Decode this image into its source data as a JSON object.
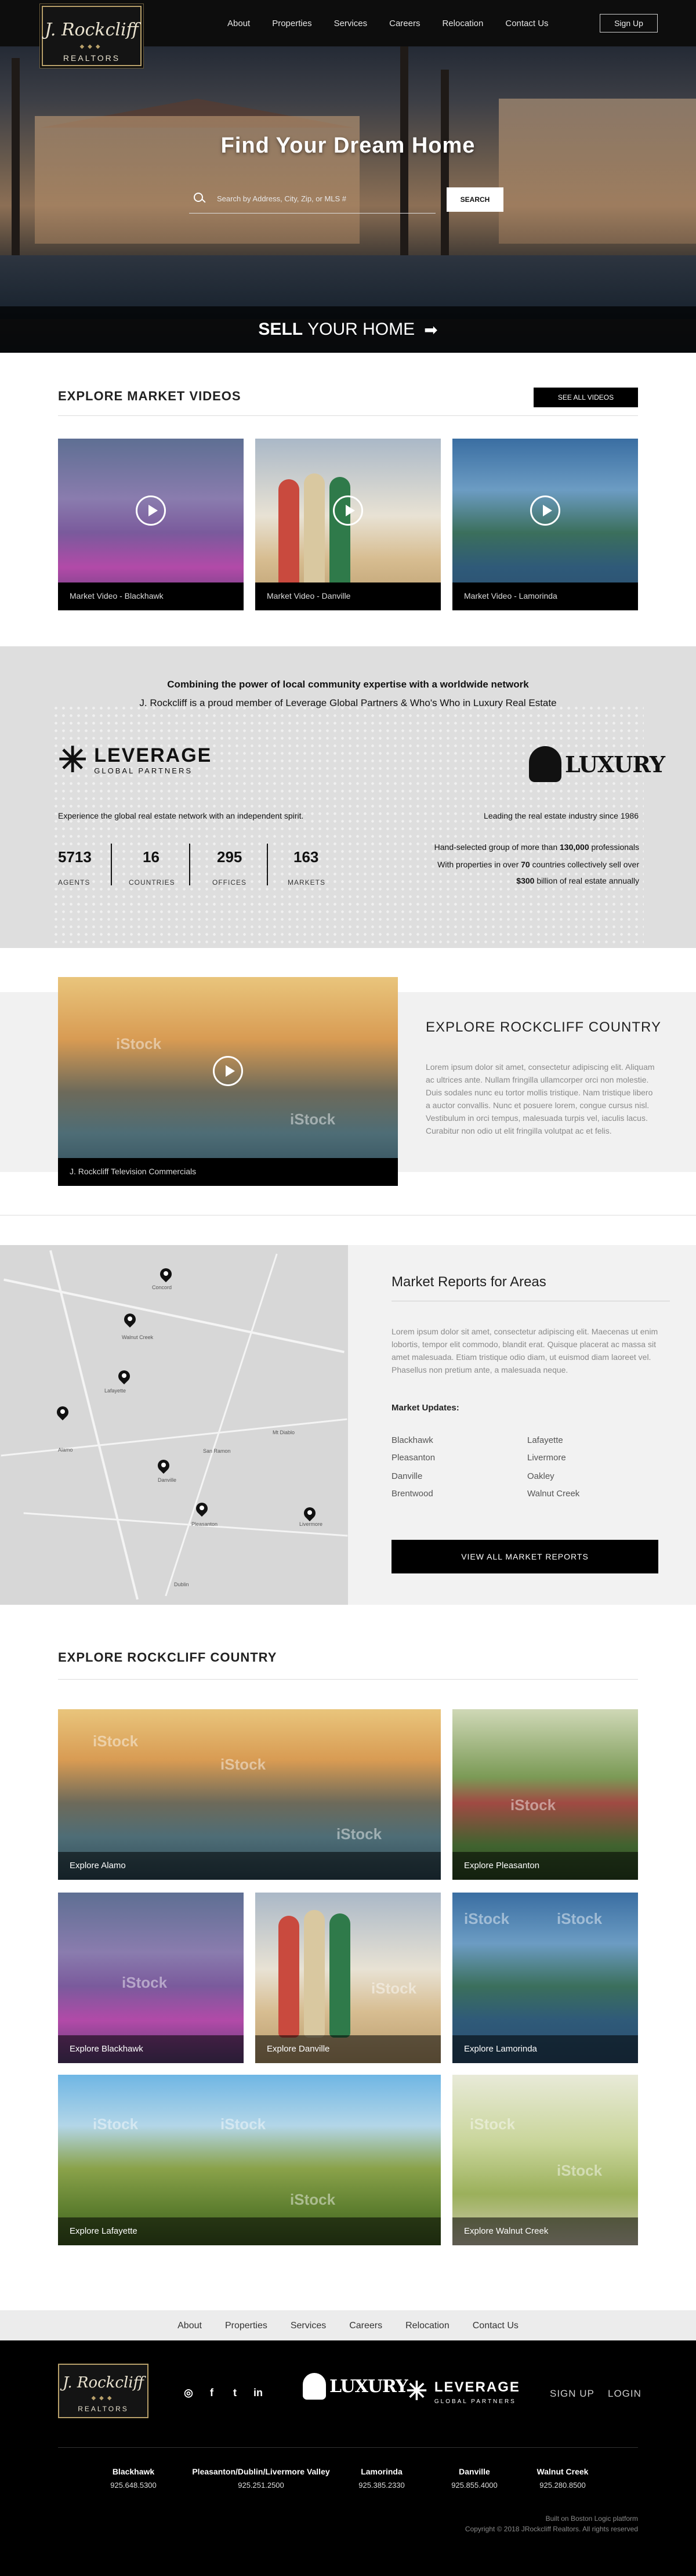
{
  "header": {
    "logo_script": "J. Rockcliff",
    "logo_sub": "REALTORS",
    "nav": [
      "About",
      "Properties",
      "Services",
      "Careers",
      "Relocation",
      "Contact Us"
    ],
    "signup": "Sign Up"
  },
  "hero": {
    "title": "Find Your Dream Home",
    "search_placeholder": "Search by Address, City, Zip, or MLS #",
    "search_button": "SEARCH",
    "sell_bold": "SELL",
    "sell_rest": "YOUR HOME"
  },
  "videos": {
    "title": "EXPLORE MARKET VIDEOS",
    "see_all": "SEE ALL VIDEOS",
    "items": [
      {
        "caption": "Market Video - Blackhawk"
      },
      {
        "caption": "Market Video - Danville"
      },
      {
        "caption": "Market Video - Lamorinda"
      }
    ]
  },
  "leverage": {
    "headline_1": "Combining the power of local community expertise with a worldwide network",
    "headline_2": "J. Rockcliff is a proud member of Leverage Global Partners & Who's Who in Luxury Real Estate",
    "lev_name": "LEVERAGE",
    "lev_sub": "GLOBAL PARTNERS",
    "lux_name": "LUXURY",
    "left_tagline": "Experience the global real estate network with an independent spirit.",
    "right_tagline": "Leading the real estate industry since 1986",
    "stats": [
      {
        "num": "5713",
        "label": "AGENTS"
      },
      {
        "num": "16",
        "label": "COUNTRIES"
      },
      {
        "num": "295",
        "label": "OFFICES"
      },
      {
        "num": "163",
        "label": "MARKETS"
      }
    ],
    "lux_l1_pre": "Hand-selected group of more than ",
    "lux_l1_bold": "130,000",
    "lux_l1_post": " professionals",
    "lux_l2_pre": "With properties in over ",
    "lux_l2_bold": "70",
    "lux_l2_post": " countries collectively sell over",
    "lux_l3_bold": "$300",
    "lux_l3_post": " billion of real estate annually"
  },
  "feature": {
    "caption": "J. Rockcliff Television Commercials",
    "title": "EXPLORE ROCKCLIFF COUNTRY",
    "text": "Lorem ipsum dolor sit amet, consectetur adipiscing elit. Aliquam ac ultrices ante. Nullam fringilla ullamcorper orci non molestie. Duis sodales nunc eu tortor mollis tristique. Nam tristique libero a auctor convallis. Nunc et posuere lorem, congue cursus nisl. Vestibulum in orci tempus, malesuada turpis vel, iaculis lacus. Curabitur non odio ut elit fringilla volutpat ac et felis."
  },
  "reports": {
    "title": "Market Reports for Areas",
    "text": "Lorem ipsum dolor sit amet, consectetur adipiscing elit. Maecenas ut enim lobortis, tempor elit commodo, blandit erat. Quisque placerat ac massa sit amet malesuada. Etiam tristique odio diam, ut euismod diam laoreet vel. Phasellus non pretium ante, a malesuada neque.",
    "updates_label": "Market Updates:",
    "left_links": [
      "Blackhawk",
      "Pleasanton",
      "Danville",
      "Brentwood"
    ],
    "right_links": [
      "Lafayette",
      "Livermore",
      "Oakley",
      "Walnut Creek"
    ],
    "button": "VIEW ALL MARKET REPORTS",
    "map_labels": [
      "Concord",
      "Walnut Creek",
      "Lafayette",
      "Alamo",
      "Danville",
      "Mt Diablo",
      "Pleasanton",
      "Livermore",
      "Dublin",
      "San Ramon"
    ]
  },
  "explore": {
    "title": "EXPLORE ROCKCLIFF COUNTRY",
    "watermark": "iStock",
    "tiles": [
      {
        "caption": "Explore Alamo"
      },
      {
        "caption": "Explore Pleasanton"
      },
      {
        "caption": "Explore Blackhawk"
      },
      {
        "caption": "Explore Danville"
      },
      {
        "caption": "Explore Lamorinda"
      },
      {
        "caption": "Explore Lafayette"
      },
      {
        "caption": "Explore Walnut Creek"
      }
    ]
  },
  "footer": {
    "nav": [
      "About",
      "Properties",
      "Services",
      "Careers",
      "Relocation",
      "Contact Us"
    ],
    "logo_script": "J. Rockcliff",
    "logo_sub": "REALTORS",
    "social": [
      "instagram-icon",
      "facebook-icon",
      "twitter-icon",
      "linkedin-icon"
    ],
    "social_glyphs": [
      "◎",
      "f",
      "t",
      "in"
    ],
    "lux_name": "LUXURY",
    "lev_name": "LEVERAGE",
    "lev_sub": "GLOBAL PARTNERS",
    "signup": "SIGN UP",
    "login": "LOGIN",
    "offices": [
      {
        "name": "Blackhawk",
        "phone": "925.648.5300"
      },
      {
        "name": "Pleasanton/Dublin/Livermore Valley",
        "phone": "925.251.2500"
      },
      {
        "name": "Lamorinda",
        "phone": "925.385.2330"
      },
      {
        "name": "Danville",
        "phone": "925.855.4000"
      },
      {
        "name": "Walnut Creek",
        "phone": "925.280.8500"
      }
    ],
    "credit_1": "Built on Boston Logic platform",
    "credit_2": "Copyright © 2018 JRockcliff Realtors. All rights reserved"
  },
  "colors": {
    "accent_gold": "#b8a06a",
    "black": "#000000",
    "band_grey": "#dedede"
  }
}
